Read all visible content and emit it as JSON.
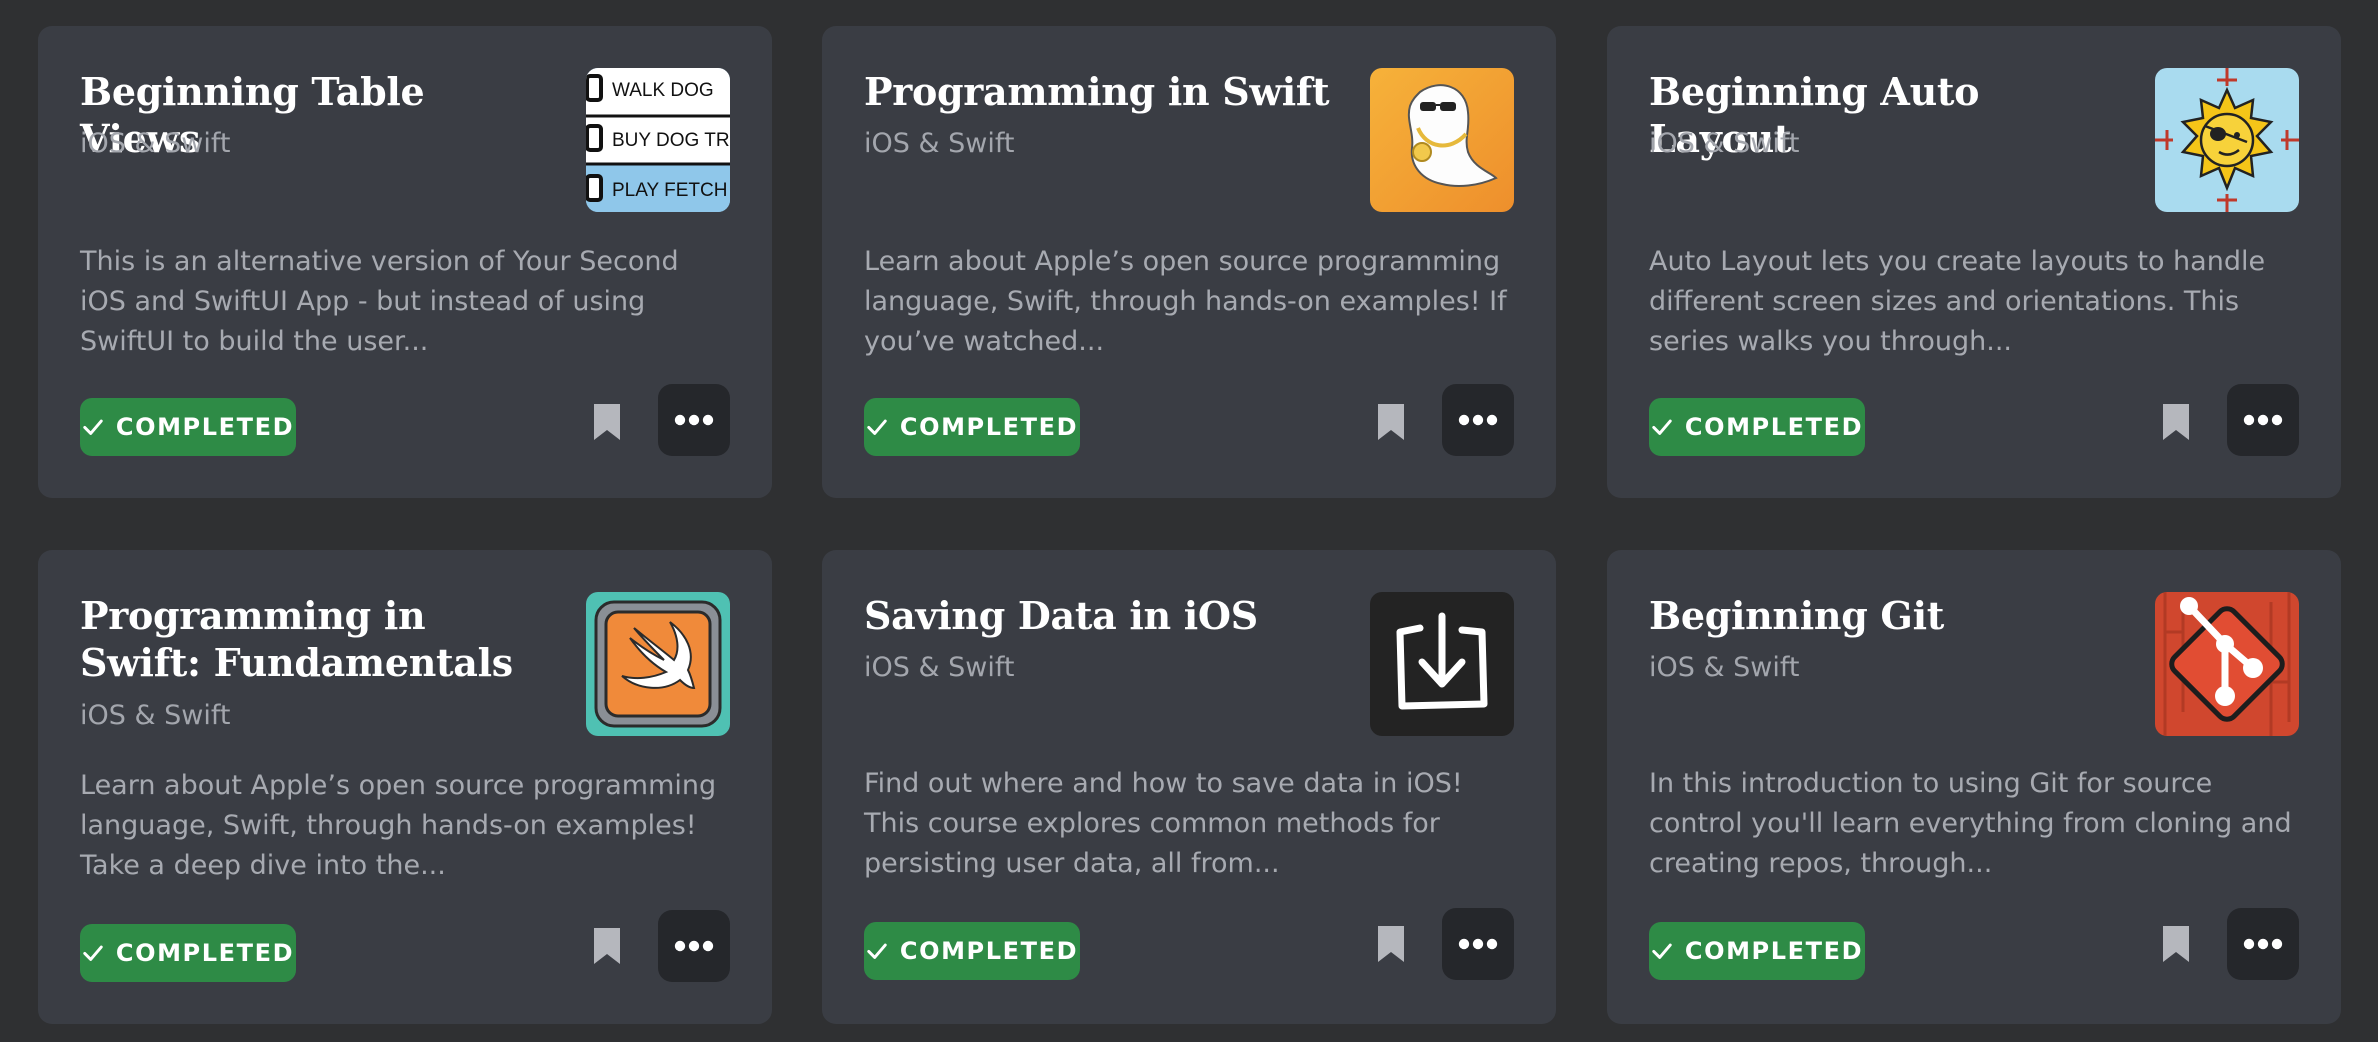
{
  "courses": [
    {
      "title": "Beginning Table Views",
      "category": "iOS & Swift",
      "description": "This is an alternative version of Your Second iOS and SwiftUI App - but instead of using SwiftUI to build the user...",
      "status": "COMPLETED",
      "artwork_text": [
        "WALK DOG",
        "BUY DOG TREAT",
        "PLAY FETCH"
      ]
    },
    {
      "title": "Programming in Swift",
      "category": "iOS & Swift",
      "description": "Learn about Apple’s open source programming language, Swift, through hands-on examples! If you’ve watched...",
      "status": "COMPLETED"
    },
    {
      "title": "Beginning Auto Layout",
      "category": "iOS & Swift",
      "description": "Auto Layout lets you create layouts to handle different screen sizes and orientations. This series walks you through...",
      "status": "COMPLETED"
    },
    {
      "title": "Programming in Swift: Fundamentals",
      "category": "iOS & Swift",
      "description": "Learn about Apple’s open source programming language, Swift, through hands-on examples! Take a deep dive into the...",
      "status": "COMPLETED"
    },
    {
      "title": "Saving Data in iOS",
      "category": "iOS & Swift",
      "description": "Find out where and how to save data in iOS! This course explores common methods for persisting user data, all from...",
      "status": "COMPLETED"
    },
    {
      "title": "Beginning Git",
      "category": "iOS & Swift",
      "description": "In this introduction to using Git for source control you'll learn everything from cloning and creating repos, through...",
      "status": "COMPLETED"
    }
  ],
  "icons": {
    "status": "checkmark-icon",
    "bookmark": "bookmark-icon",
    "more": "more-options-icon"
  },
  "colors": {
    "page_background": "#2f3032",
    "card_background": "#3a3d44",
    "completed_badge": "#2e8b46",
    "more_button": "#25272b"
  }
}
